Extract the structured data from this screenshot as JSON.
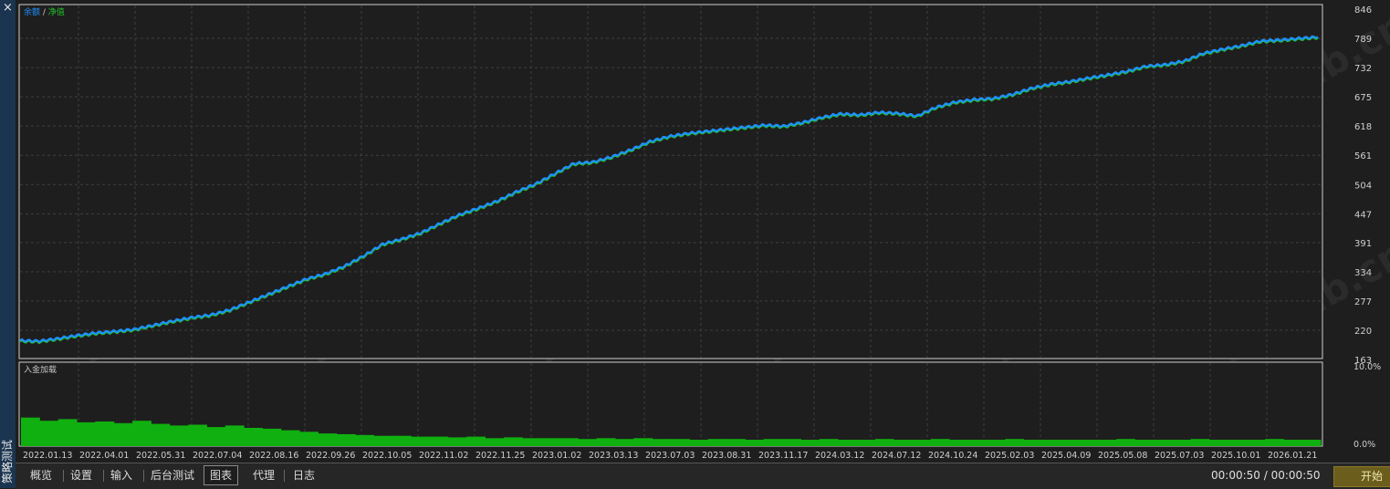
{
  "sidebar": {
    "close_icon": "×",
    "title": "策略测试"
  },
  "tabs": [
    {
      "label": "概览",
      "active": false
    },
    {
      "label": "设置",
      "active": false
    },
    {
      "label": "输入",
      "active": false
    },
    {
      "label": "后台测试",
      "active": false
    },
    {
      "label": "图表",
      "active": true
    },
    {
      "label": "代理",
      "active": false
    },
    {
      "label": "日志",
      "active": false
    }
  ],
  "timer": "00:00:50 / 00:00:50",
  "start_button": "开始",
  "watermark": "EAHub.cn",
  "colors": {
    "balance": "#1e90ff",
    "equity": "#22c02a",
    "deposit_load": "#10b010",
    "grid": "#3e3e3e",
    "background": "#1e1e1e"
  },
  "chart_data": [
    {
      "type": "line",
      "legend": {
        "balance": "余额",
        "separator": " / ",
        "equity": "净值"
      },
      "y_ticks": [
        846,
        789,
        732,
        675,
        618,
        561,
        504,
        447,
        391,
        334,
        277,
        220,
        163
      ],
      "ylim": [
        163,
        846
      ],
      "grid": true,
      "series": [
        {
          "name": "余额",
          "color": "#1e90ff",
          "values": [
            200,
            199,
            204,
            210,
            215,
            218,
            222,
            230,
            238,
            245,
            250,
            260,
            275,
            290,
            305,
            320,
            330,
            345,
            365,
            388,
            398,
            410,
            428,
            445,
            458,
            472,
            490,
            505,
            525,
            545,
            548,
            558,
            572,
            588,
            598,
            604,
            608,
            612,
            616,
            620,
            618,
            625,
            635,
            642,
            640,
            645,
            643,
            638,
            655,
            665,
            670,
            672,
            680,
            692,
            700,
            705,
            712,
            718,
            725,
            735,
            738,
            745,
            760,
            768,
            775,
            784,
            786,
            789,
            792
          ]
        },
        {
          "name": "净值",
          "color": "#22c02a",
          "values": [
            198,
            197,
            202,
            208,
            213,
            216,
            220,
            228,
            236,
            243,
            248,
            258,
            273,
            288,
            303,
            318,
            328,
            343,
            363,
            386,
            396,
            408,
            426,
            443,
            456,
            470,
            488,
            503,
            523,
            543,
            546,
            556,
            570,
            586,
            596,
            602,
            606,
            610,
            614,
            618,
            616,
            623,
            633,
            640,
            638,
            643,
            641,
            636,
            653,
            663,
            668,
            670,
            678,
            690,
            698,
            703,
            710,
            716,
            723,
            733,
            736,
            743,
            758,
            766,
            773,
            782,
            784,
            787,
            790
          ]
        }
      ]
    },
    {
      "type": "bar",
      "title": "入金加载",
      "y_ticks": [
        "10.0%",
        "0.0%"
      ],
      "ylim": [
        0,
        10
      ],
      "series": [
        {
          "name": "入金加载",
          "color": "#10b010",
          "values": [
            3.6,
            3.2,
            3.4,
            3.0,
            3.1,
            2.9,
            3.2,
            2.8,
            2.6,
            2.7,
            2.4,
            2.6,
            2.3,
            2.2,
            2.0,
            1.8,
            1.6,
            1.5,
            1.4,
            1.3,
            1.3,
            1.2,
            1.2,
            1.1,
            1.2,
            1.0,
            1.1,
            1.0,
            1.0,
            1.0,
            0.9,
            1.0,
            0.9,
            1.0,
            0.9,
            0.9,
            0.8,
            0.9,
            0.9,
            0.8,
            0.9,
            0.9,
            0.8,
            0.9,
            0.8,
            0.8,
            0.9,
            0.8,
            0.8,
            0.9,
            0.8,
            0.8,
            0.8,
            0.9,
            0.8,
            0.8,
            0.8,
            0.8,
            0.8,
            0.9,
            0.8,
            0.8,
            0.8,
            0.9,
            0.8,
            0.8,
            0.8,
            0.9,
            0.8,
            0.8
          ]
        }
      ]
    }
  ],
  "x_ticks": [
    "2022.01.13",
    "2022.04.01",
    "2022.05.31",
    "2022.07.04",
    "2022.08.16",
    "2022.09.26",
    "2022.10.05",
    "2022.11.02",
    "2022.11.25",
    "2023.01.02",
    "2023.03.13",
    "2023.07.03",
    "2023.08.31",
    "2023.11.17",
    "2024.03.12",
    "2024.07.12",
    "2024.10.24",
    "2025.02.03",
    "2025.04.09",
    "2025.05.08",
    "2025.07.03",
    "2025.10.01",
    "2026.01.21"
  ]
}
